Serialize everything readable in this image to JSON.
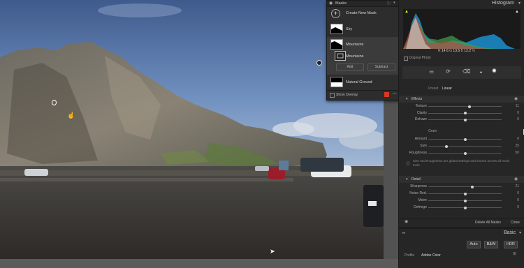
{
  "masks_panel": {
    "title": "Masks",
    "create_label": "Create New Mask",
    "items": [
      {
        "label": "Sky"
      },
      {
        "label": "Mountains"
      },
      {
        "label": "Mountains"
      },
      {
        "label": "Natural Ground"
      }
    ],
    "add_label": "Add",
    "subtract_label": "Subtract",
    "show_overlay_label": "Show Overlay",
    "overlay_color": "#d8391f"
  },
  "histogram": {
    "title": "Histogram",
    "original_photo_label": "Original Photo",
    "readout": {
      "r_label": "R",
      "r_value": "14.6",
      "g_label": "G",
      "g_value": "13.6",
      "b_label": "B",
      "b_value": "12.2",
      "pct": "%"
    }
  },
  "tabs": {
    "preset_label": "Preset",
    "linear_label": "Linear"
  },
  "effects": {
    "title": "Effects",
    "sliders": [
      {
        "label": "Texture",
        "value": "11",
        "level": 0.56
      },
      {
        "label": "Clarity",
        "value": "0",
        "level": 0.5
      },
      {
        "label": "Dehaze",
        "value": "0",
        "level": 0.5
      }
    ]
  },
  "grain": {
    "title": "Grain",
    "sliders": [
      {
        "label": "Amount",
        "value": "0",
        "level": 0.5
      },
      {
        "label": "Size",
        "value": "25",
        "level": 0.25
      },
      {
        "label": "Roughness",
        "value": "50",
        "level": 0.5
      }
    ],
    "note": "Size and Roughness are global settings and shared across all Grain tools."
  },
  "detail": {
    "title": "Detail",
    "sliders": [
      {
        "label": "Sharpness",
        "value": "21",
        "level": 0.6
      },
      {
        "label": "Noise Red.",
        "value": "0",
        "level": 0.5
      },
      {
        "label": "Moire",
        "value": "0",
        "level": 0.5
      },
      {
        "label": "Defringe",
        "value": "0",
        "level": 0.5
      }
    ]
  },
  "footer": {
    "delete_all_label": "Delete All Masks",
    "close_label": "Close"
  },
  "basic": {
    "title": "Basic",
    "auto_label": "Auto",
    "bw_label": "B&W",
    "hdr_label": "HDR",
    "profile_label": "Profile",
    "profile_value": "Adobe Color"
  },
  "colors": {
    "accent_red": "#d8391f",
    "panel_bg": "#262626"
  }
}
